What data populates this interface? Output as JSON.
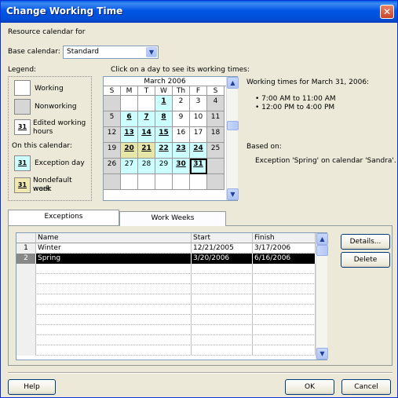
{
  "window": {
    "title": "Change Working Time",
    "close_symbol": "✕"
  },
  "resource_calendar_for": "Resource calendar for",
  "base_calendar": {
    "label": "Base calendar:",
    "value": "Standard"
  },
  "legend": {
    "title": "Legend:",
    "working": "Working",
    "nonworking": "Nonworking",
    "edited_line1": "Edited working",
    "edited_line2": "hours",
    "edited_num": "31",
    "on_this_calendar": "On this calendar:",
    "exception_day": "Exception day",
    "exception_num": "31",
    "nondefault_line1": "Nondefault work",
    "nondefault_line2": "week",
    "nondefault_num": "31"
  },
  "calendar": {
    "instruction": "Click on a day to see its working times:",
    "month": "March 2006",
    "dow": [
      "S",
      "M",
      "T",
      "W",
      "Th",
      "F",
      "S"
    ],
    "weeks": [
      [
        "",
        "",
        "",
        "1",
        "2",
        "3",
        "4"
      ],
      [
        "5",
        "6",
        "7",
        "8",
        "9",
        "10",
        "11"
      ],
      [
        "12",
        "13",
        "14",
        "15",
        "16",
        "17",
        "18"
      ],
      [
        "19",
        "20",
        "21",
        "22",
        "23",
        "24",
        "25"
      ],
      [
        "26",
        "27",
        "28",
        "29",
        "30",
        "31",
        ""
      ],
      [
        "",
        "",
        "",
        "",
        "",
        "",
        ""
      ]
    ],
    "selected_day": "31"
  },
  "working_times": {
    "heading": "Working times for March 31, 2006:",
    "time1": "• 7:00 AM to 11:00 AM",
    "time2": "• 12:00 PM to 4:00 PM",
    "based_on": "Based on:",
    "based_on_detail": "Exception 'Spring' on calendar 'Sandra'."
  },
  "tabs": {
    "exceptions": "Exceptions",
    "work_weeks": "Work Weeks"
  },
  "table": {
    "headers": {
      "name": "Name",
      "start": "Start",
      "finish": "Finish"
    },
    "rows": [
      {
        "num": "1",
        "name": "Winter",
        "start": "12/21/2005",
        "finish": "3/17/2006"
      },
      {
        "num": "2",
        "name": "Spring",
        "start": "3/20/2006",
        "finish": "6/16/2006"
      }
    ]
  },
  "buttons": {
    "details": "Details...",
    "delete": "Delete",
    "help": "Help",
    "ok": "OK",
    "cancel": "Cancel"
  },
  "scroll": {
    "up": "▲",
    "down": "▼",
    "combo_arrow": "▼"
  }
}
